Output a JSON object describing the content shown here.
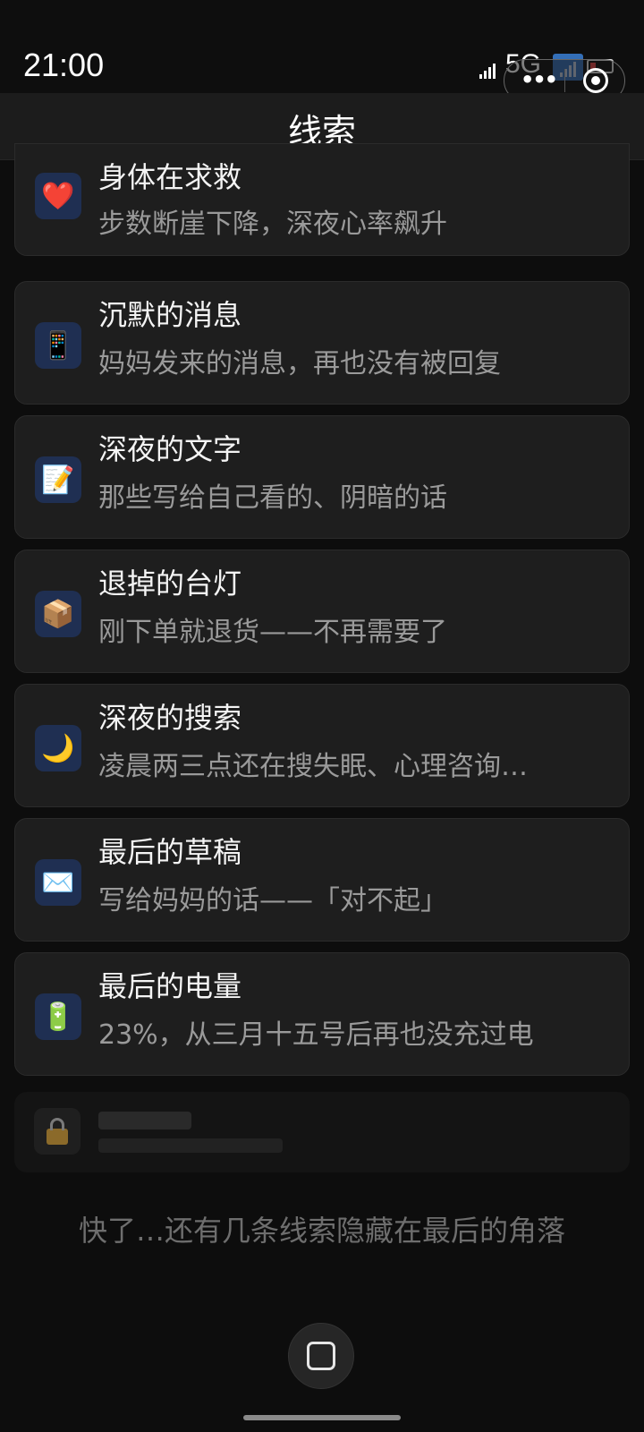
{
  "status_bar": {
    "time": "21:00",
    "network": "5G"
  },
  "header": {
    "title": "线索"
  },
  "clues": [
    {
      "icon": "❤️",
      "icon_name": "heart-icon",
      "title": "身体在求救",
      "subtitle": "步数断崖下降，深夜心率飙升"
    },
    {
      "icon": "📱",
      "icon_name": "phone-icon",
      "title": "沉默的消息",
      "subtitle": "妈妈发来的消息，再也没有被回复"
    },
    {
      "icon": "📝",
      "icon_name": "memo-icon",
      "title": "深夜的文字",
      "subtitle": "那些写给自己看的、阴暗的话"
    },
    {
      "icon": "📦",
      "icon_name": "package-icon",
      "title": "退掉的台灯",
      "subtitle": "刚下单就退货——不再需要了"
    },
    {
      "icon": "🌙",
      "icon_name": "moon-icon",
      "title": "深夜的搜索",
      "subtitle": "凌晨两三点还在搜失眠、心理咨询…"
    },
    {
      "icon": "✉️",
      "icon_name": "envelope-icon",
      "title": "最后的草稿",
      "subtitle": "写给妈妈的话——「对不起」"
    },
    {
      "icon": "🔋",
      "icon_name": "battery-icon",
      "title": "最后的电量",
      "subtitle": "23%，从三月十五号后再也没充过电"
    }
  ],
  "footer_hint": "快了…还有几条线索隐藏在最后的角落"
}
